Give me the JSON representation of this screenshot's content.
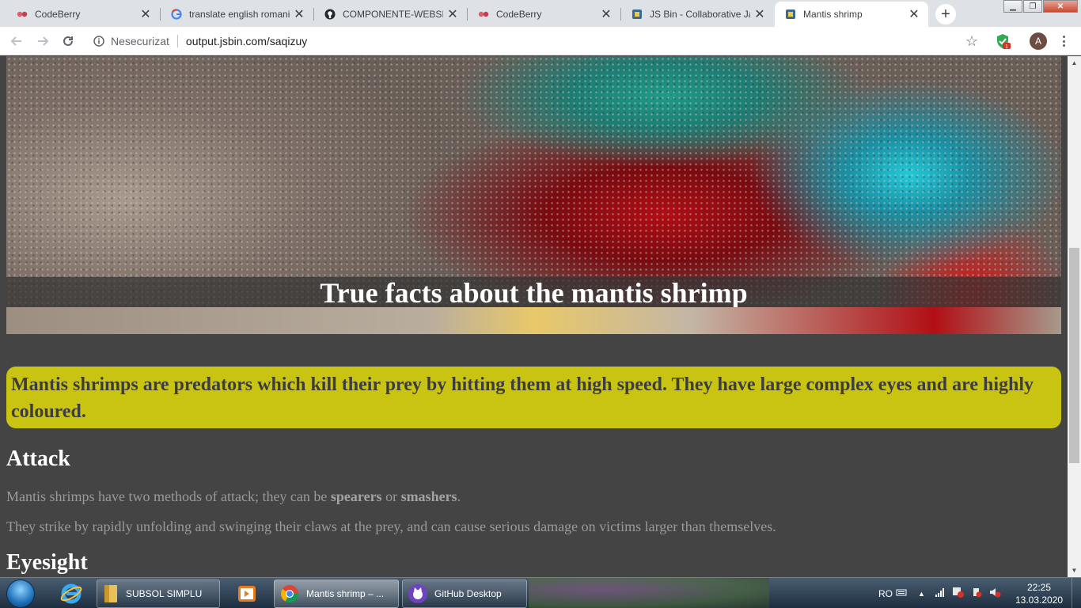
{
  "browser": {
    "tabs": [
      {
        "title": "CodeBerry",
        "icon": "codeberry-icon"
      },
      {
        "title": "translate english romanian",
        "icon": "google-icon"
      },
      {
        "title": "COMPONENTE-WEBSITE",
        "icon": "github-icon"
      },
      {
        "title": "CodeBerry",
        "icon": "codeberry-icon"
      },
      {
        "title": "JS Bin - Collaborative JavaScript",
        "icon": "jsbin-icon"
      },
      {
        "title": "Mantis shrimp",
        "icon": "jsbin-icon",
        "active": true
      }
    ],
    "security_label": "Nesecurizat",
    "url": "output.jsbin.com/saqizuy",
    "extension_badge": "1",
    "avatar_letter": "A"
  },
  "page": {
    "hero_title": "True facts about the mantis shrimp",
    "intro": "Mantis shrimps are predators which kill their prey by hitting them at high speed. They have large complex eyes and are highly coloured.",
    "attack_heading": "Attack",
    "attack_p1_before": "Mantis shrimps have two methods of attack; they can be ",
    "attack_p1_b1": "spearers",
    "attack_p1_mid": " or ",
    "attack_p1_b2": "smashers",
    "attack_p1_after": ".",
    "attack_p2": "They strike by rapidly unfolding and swinging their claws at the prey, and can cause serious damage on victims larger than themselves.",
    "eyesight_heading": "Eyesight"
  },
  "taskbar": {
    "tasks": [
      {
        "label": "SUBSOL SIMPLU",
        "icon": "folder-icon"
      },
      {
        "label": "Mantis shrimp – ...",
        "icon": "chrome-icon",
        "active": true
      },
      {
        "label": "GitHub Desktop",
        "icon": "github-desktop-icon"
      }
    ],
    "language": "RO",
    "time": "22:25",
    "date": "13.03.2020"
  },
  "colors": {
    "page_bg": "#444444",
    "intro_bg": "#c9c312",
    "heading": "#ffffff",
    "body_text": "#9a9a9a"
  }
}
